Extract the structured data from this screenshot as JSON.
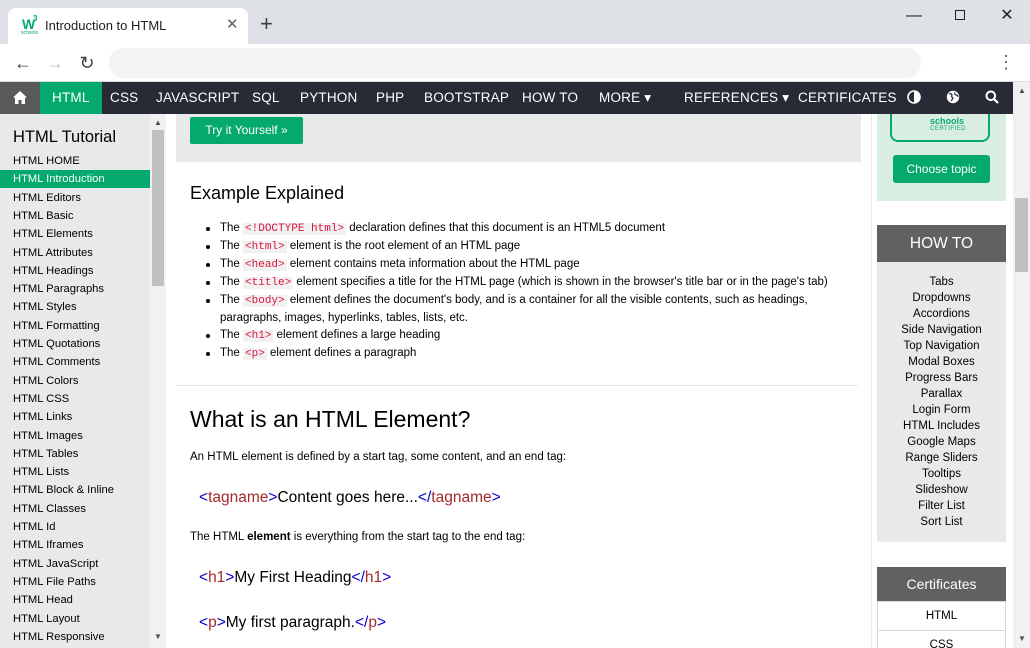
{
  "browser": {
    "tab_title": "Introduction to HTML",
    "favicon_text": "W",
    "favicon_sup": "3",
    "favicon_small": "schools",
    "close_glyph": "✕",
    "newtab_glyph": "+",
    "minimize_glyph": "—",
    "close_window_glyph": "✕",
    "back_glyph": "←",
    "forward_glyph": "→",
    "reload_glyph": "↻",
    "menu_glyph": "⋮",
    "omnibox_value": ""
  },
  "topnav": {
    "items": [
      "HTML",
      "CSS",
      "JAVASCRIPT",
      "SQL",
      "PYTHON",
      "PHP",
      "BOOTSTRAP",
      "HOW TO",
      "MORE ▾",
      "REFERENCES ▾",
      "CERTIFICATES"
    ],
    "active": "HTML",
    "accent": "#04aa6d",
    "bg": "#282a35"
  },
  "sidebar": {
    "heading": "HTML Tutorial",
    "links": [
      "HTML HOME",
      "HTML Introduction",
      "HTML Editors",
      "HTML Basic",
      "HTML Elements",
      "HTML Attributes",
      "HTML Headings",
      "HTML Paragraphs",
      "HTML Styles",
      "HTML Formatting",
      "HTML Quotations",
      "HTML Comments",
      "HTML Colors",
      "HTML CSS",
      "HTML Links",
      "HTML Images",
      "HTML Tables",
      "HTML Lists",
      "HTML Block & Inline",
      "HTML Classes",
      "HTML Id",
      "HTML Iframes",
      "HTML JavaScript",
      "HTML File Paths",
      "HTML Head",
      "HTML Layout",
      "HTML Responsive"
    ],
    "active_index": 1
  },
  "main": {
    "try_button": "Try it Yourself »",
    "example_heading": "Example Explained",
    "bullets": [
      {
        "pre": "The ",
        "code": "<!DOCTYPE html>",
        "post": " declaration defines that this document is an HTML5 document"
      },
      {
        "pre": "The ",
        "code": "<html>",
        "post": " element is the root element of an HTML page"
      },
      {
        "pre": "The ",
        "code": "<head>",
        "post": " element contains meta information about the HTML page"
      },
      {
        "pre": "The ",
        "code": "<title>",
        "post": " element specifies a title for the HTML page (which is shown in the browser's title bar or in the page's tab)"
      },
      {
        "pre": "The ",
        "code": "<body>",
        "post": " element defines the document's body, and is a container for all the visible contents, such as headings, paragraphs, images, hyperlinks, tables, lists, etc."
      },
      {
        "pre": "The ",
        "code": "<h1>",
        "post": " element defines a large heading"
      },
      {
        "pre": "The ",
        "code": "<p>",
        "post": " element defines a paragraph"
      }
    ],
    "element_heading": "What is an HTML Element?",
    "element_intro": "An HTML element is defined by a start tag, some content, and an end tag:",
    "syntax": {
      "open_lt": "<",
      "open_name": "tagname",
      "open_gt": ">",
      "content": "Content goes here...",
      "close_lt": "</",
      "close_name": "tagname",
      "close_gt": ">"
    },
    "element_desc_pre": "The HTML ",
    "element_desc_bold": "element",
    "element_desc_post": " is everything from the start tag to the end tag:",
    "example1": {
      "open_lt": "<",
      "open_name": "h1",
      "open_gt": ">",
      "content": "My First Heading",
      "close_lt": "</",
      "close_name": "h1",
      "close_gt": ">"
    },
    "example2": {
      "open_lt": "<",
      "open_name": "p",
      "open_gt": ">",
      "content": "My first paragraph.",
      "close_lt": "</",
      "close_name": "p",
      "close_gt": ">"
    }
  },
  "right": {
    "cert_logo_line1": "schools",
    "cert_logo_line2": "CERTIFIED",
    "choose_topic": "Choose topic",
    "howto_heading": "HOW TO",
    "howto_links": [
      "Tabs",
      "Dropdowns",
      "Accordions",
      "Side Navigation",
      "Top Navigation",
      "Modal Boxes",
      "Progress Bars",
      "Parallax",
      "Login Form",
      "HTML Includes",
      "Google Maps",
      "Range Sliders",
      "Tooltips",
      "Slideshow",
      "Filter List",
      "Sort List"
    ],
    "certs_heading": "Certificates",
    "certs_links": [
      "HTML",
      "CSS"
    ]
  }
}
